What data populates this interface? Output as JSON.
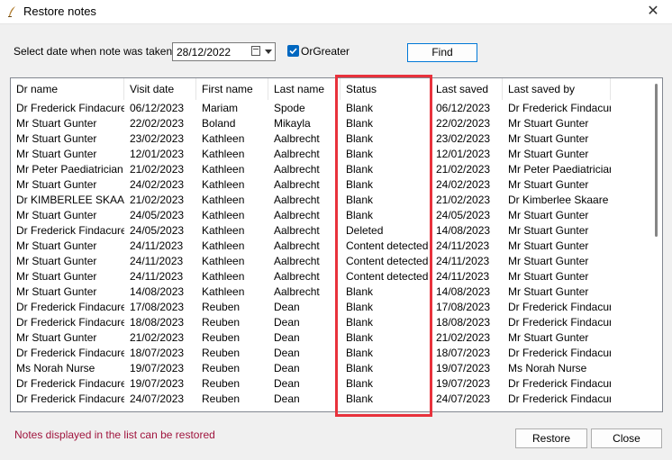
{
  "window": {
    "title": "Restore notes"
  },
  "filter": {
    "date_label": "Select date when note was taken:",
    "date_value": "28/12/2022",
    "or_greater_label": "OrGreater",
    "or_greater_checked": true,
    "find_label": "Find"
  },
  "table": {
    "columns": [
      "Dr name",
      "Visit date",
      "First name",
      "Last name",
      "Status",
      "Last saved",
      "Last saved by"
    ],
    "rows": [
      [
        "Dr Frederick Findacure",
        "06/12/2023",
        "Mariam",
        "Spode",
        "Blank",
        "06/12/2023",
        "Dr Frederick Findacure"
      ],
      [
        "Mr Stuart Gunter",
        "22/02/2023",
        "Boland",
        "Mikayla",
        "Blank",
        "22/02/2023",
        "Mr Stuart Gunter"
      ],
      [
        "Mr Stuart Gunter",
        "23/02/2023",
        "Kathleen",
        "Aalbrecht",
        "Blank",
        "23/02/2023",
        "Mr Stuart Gunter"
      ],
      [
        "Mr Stuart Gunter",
        "12/01/2023",
        "Kathleen",
        "Aalbrecht",
        "Blank",
        "12/01/2023",
        "Mr Stuart Gunter"
      ],
      [
        "Mr Peter Paediatrician",
        "21/02/2023",
        "Kathleen",
        "Aalbrecht",
        "Blank",
        "21/02/2023",
        "Mr Peter Paediatrician"
      ],
      [
        "Mr Stuart Gunter",
        "24/02/2023",
        "Kathleen",
        "Aalbrecht",
        "Blank",
        "24/02/2023",
        "Mr Stuart Gunter"
      ],
      [
        "Dr KIMBERLEE SKAA...",
        "21/02/2023",
        "Kathleen",
        "Aalbrecht",
        "Blank",
        "21/02/2023",
        "Dr Kimberlee Skaare"
      ],
      [
        "Mr Stuart Gunter",
        "24/05/2023",
        "Kathleen",
        "Aalbrecht",
        "Blank",
        "24/05/2023",
        "Mr Stuart Gunter"
      ],
      [
        "Dr Frederick Findacure",
        "24/05/2023",
        "Kathleen",
        "Aalbrecht",
        "Deleted",
        "14/08/2023",
        "Mr Stuart Gunter"
      ],
      [
        "Mr Stuart Gunter",
        "24/11/2023",
        "Kathleen",
        "Aalbrecht",
        "Content detected",
        "24/11/2023",
        "Mr Stuart Gunter"
      ],
      [
        "Mr Stuart Gunter",
        "24/11/2023",
        "Kathleen",
        "Aalbrecht",
        "Content detected",
        "24/11/2023",
        "Mr Stuart Gunter"
      ],
      [
        "Mr Stuart Gunter",
        "24/11/2023",
        "Kathleen",
        "Aalbrecht",
        "Content detected",
        "24/11/2023",
        "Mr Stuart Gunter"
      ],
      [
        "Mr Stuart Gunter",
        "14/08/2023",
        "Kathleen",
        "Aalbrecht",
        "Blank",
        "14/08/2023",
        "Mr Stuart Gunter"
      ],
      [
        "Dr Frederick Findacure",
        "17/08/2023",
        "Reuben",
        "Dean",
        "Blank",
        "17/08/2023",
        "Dr Frederick Findacure"
      ],
      [
        "Dr Frederick Findacure",
        "18/08/2023",
        "Reuben",
        "Dean",
        "Blank",
        "18/08/2023",
        "Dr Frederick Findacure"
      ],
      [
        "Mr Stuart Gunter",
        "21/02/2023",
        "Reuben",
        "Dean",
        "Blank",
        "21/02/2023",
        "Mr Stuart Gunter"
      ],
      [
        "Dr Frederick Findacure",
        "18/07/2023",
        "Reuben",
        "Dean",
        "Blank",
        "18/07/2023",
        "Dr Frederick Findacure"
      ],
      [
        "Ms Norah Nurse",
        "19/07/2023",
        "Reuben",
        "Dean",
        "Blank",
        "19/07/2023",
        "Ms Norah Nurse"
      ],
      [
        "Dr Frederick Findacure",
        "19/07/2023",
        "Reuben",
        "Dean",
        "Blank",
        "19/07/2023",
        "Dr Frederick Findacure"
      ],
      [
        "Dr Frederick Findacure",
        "24/07/2023",
        "Reuben",
        "Dean",
        "Blank",
        "24/07/2023",
        "Dr Frederick Findacure"
      ]
    ]
  },
  "footer": {
    "note": "Notes displayed in the list can be restored",
    "restore_label": "Restore",
    "close_label": "Close"
  },
  "colors": {
    "highlight": "#e8323c",
    "accent": "#0067c0",
    "note_text": "#a0153e"
  },
  "icons": {
    "app": "quill-icon",
    "close": "close-icon",
    "calendar": "calendar-icon",
    "dropdown": "chevron-down-icon",
    "check": "check-icon"
  }
}
